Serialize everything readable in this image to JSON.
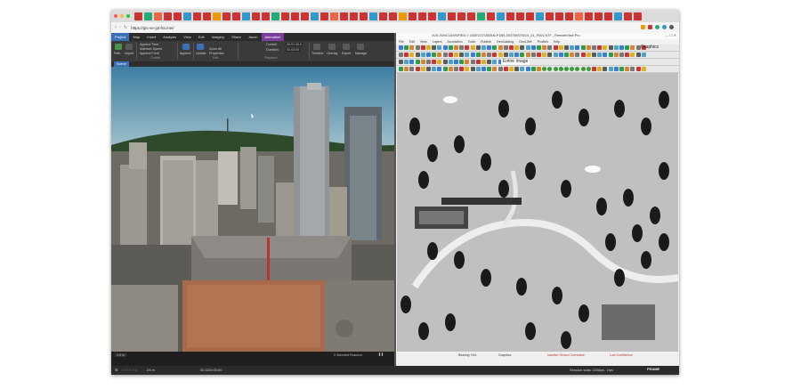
{
  "browser": {
    "url": "https://gis-ve-g3.fra.mei/",
    "tab_colors": [
      "#c33",
      "#2a7",
      "#e64",
      "#c33",
      "#c33",
      "#39c",
      "#c33",
      "#c33",
      "#e90",
      "#c33",
      "#c33",
      "#39c",
      "#c33",
      "#c33",
      "#2a7",
      "#c33",
      "#c33",
      "#c33",
      "#39c",
      "#c33",
      "#e64",
      "#c33",
      "#c33",
      "#c33",
      "#39c",
      "#c33",
      "#c33",
      "#e90",
      "#c33",
      "#c33",
      "#c33",
      "#39c",
      "#c33",
      "#c33",
      "#c33",
      "#2a7",
      "#c33",
      "#39c",
      "#c33",
      "#c33",
      "#c33",
      "#39c",
      "#c33",
      "#c33",
      "#c33",
      "#e64",
      "#c33",
      "#c33",
      "#c33",
      "#39c",
      "#c33",
      "#c33"
    ]
  },
  "arcgis": {
    "window_title": "ArcGIS Pro - Notebook - Scene",
    "ribbon_tabs": [
      "Project",
      "Map",
      "Insert",
      "Analysis",
      "View",
      "Edit",
      "Imagery",
      "Share",
      "Jacon",
      "Animation"
    ],
    "context_tab": "Map",
    "ribbon": {
      "append_time": "Append Time",
      "maintain_speed": "Maintain Speed",
      "append_front": "Append Front",
      "append": "Append",
      "update": "Update",
      "zoom_all": "Zoom All",
      "properties": "Properties",
      "current": "Current",
      "duration": "Duration",
      "current_value": "00:01:40.6",
      "duration_value": "00:03:00",
      "timeline": "Timeline",
      "overlay": "Overlay",
      "export": "Export",
      "manage": "Manage",
      "create_group": "Create",
      "edit_group": "Edit",
      "playback_group": "Playback",
      "path": "Path",
      "import": "Import"
    },
    "view_tab": "Scene",
    "status": {
      "scale": "1:0 m",
      "selected": "0 Selected Features",
      "coords": "24 m",
      "time": "00:32/0:00:00"
    }
  },
  "remoteview": {
    "title": "//US //UNCLASSIFIED // 14DEC07155306-P1BS-053736379010_01_P001.NTF - RemoteView Pro",
    "menu": [
      "File",
      "Edit",
      "View",
      "Layers",
      "Annotation",
      "Tools",
      "Publish",
      "GeoCatalog",
      "GeoLINK",
      "Profiles",
      "Help"
    ],
    "graphics_label": "Graphics",
    "entire_image": "Entire Image",
    "status": {
      "bearing": "Bearing: N/A",
      "graphics": "Graphics",
      "inactive_sensor": "Inactive Sensor Correction",
      "low_confidence": "Low Confidence",
      "session_stats": "Session stats: 2266ps, 1fps"
    }
  },
  "bottom_bar": {
    "frame_label": "FRAME"
  }
}
